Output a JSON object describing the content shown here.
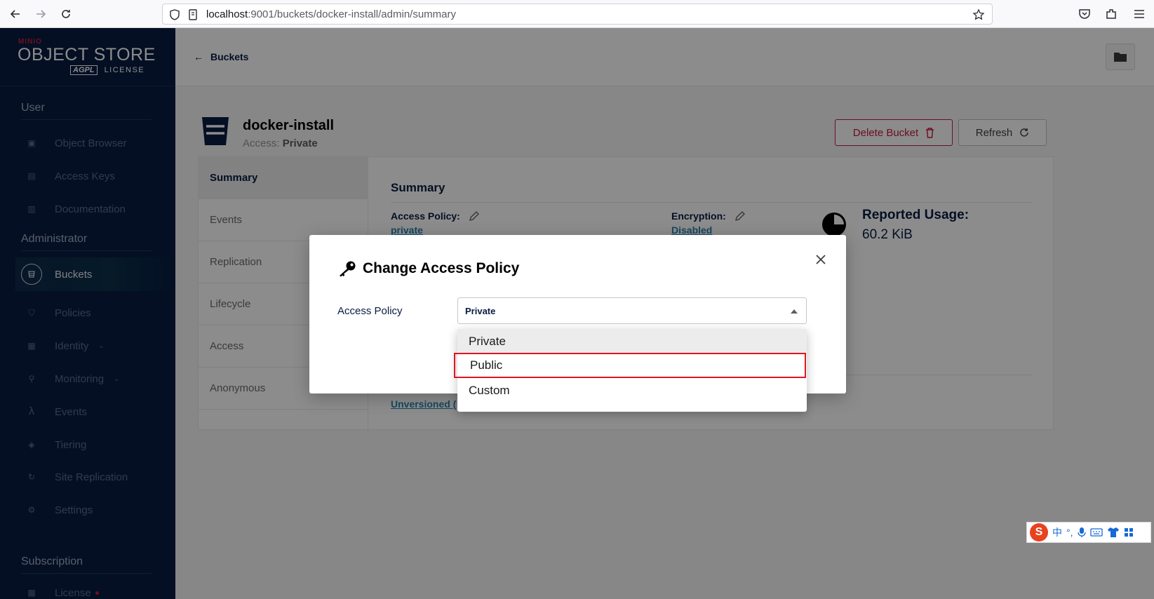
{
  "browser": {
    "url_host": "localhost",
    "url_rest": ":9001/buckets/docker-install/admin/summary"
  },
  "sidebar": {
    "logo_small": "MINIO",
    "logo_main": "OBJECT STORE",
    "logo_agpl": "AGPL",
    "logo_license": "LICENSE",
    "sections": {
      "user": "User",
      "administrator": "Administrator",
      "subscription": "Subscription"
    },
    "user_items": [
      {
        "label": "Object Browser",
        "icon": "object-browser-icon"
      },
      {
        "label": "Access Keys",
        "icon": "access-keys-icon"
      },
      {
        "label": "Documentation",
        "icon": "documentation-icon"
      }
    ],
    "admin_items": [
      {
        "label": "Buckets",
        "icon": "buckets-icon"
      },
      {
        "label": "Policies",
        "icon": "policies-icon"
      },
      {
        "label": "Identity",
        "icon": "identity-icon"
      },
      {
        "label": "Monitoring",
        "icon": "monitoring-icon"
      },
      {
        "label": "Events",
        "icon": "lambda-icon"
      },
      {
        "label": "Tiering",
        "icon": "tiering-icon"
      },
      {
        "label": "Site Replication",
        "icon": "site-replication-icon"
      },
      {
        "label": "Settings",
        "icon": "settings-icon"
      }
    ],
    "subscription_items": [
      {
        "label": "License",
        "icon": "license-icon"
      }
    ]
  },
  "topbar": {
    "back_label": "Buckets"
  },
  "bucket": {
    "name": "docker-install",
    "access_prefix": "Access: ",
    "access_value": "Private",
    "delete_label": "Delete Bucket",
    "refresh_label": "Refresh"
  },
  "tabs": [
    "Summary",
    "Events",
    "Replication",
    "Lifecycle",
    "Access",
    "Anonymous"
  ],
  "summary": {
    "title": "Summary",
    "access_policy_label": "Access Policy:",
    "access_policy_value": "private",
    "encryption_label": "Encryption:",
    "encryption_value": "Disabled",
    "usage_label": "Reported Usage:",
    "usage_value": "60.2 KiB",
    "unversioned_label": "Unversioned ("
  },
  "modal": {
    "title": "Change Access Policy",
    "field_label": "Access Policy",
    "selected_value": "Private",
    "options": [
      "Private",
      "Public",
      "Custom"
    ],
    "highlighted_option": "Public"
  },
  "ime": {
    "glyph": "S",
    "mode": "中"
  },
  "colors": {
    "sidebar_bg": "#081c42",
    "accent_red": "#c51b3f",
    "link_blue": "#2781b0",
    "highlight": "#e0161e"
  }
}
